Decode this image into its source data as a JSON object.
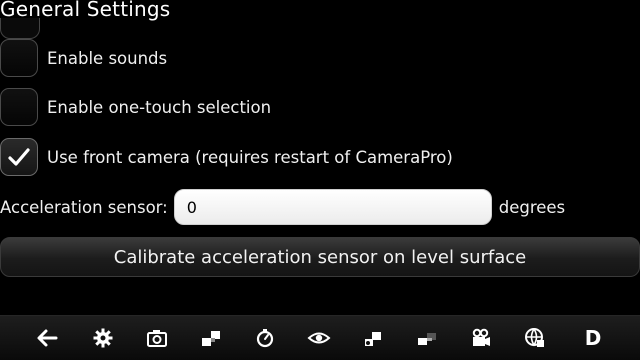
{
  "header": {
    "title": "General Settings"
  },
  "settings": {
    "sounds": {
      "label": "Enable sounds",
      "checked": false
    },
    "one_touch": {
      "label": "Enable one-touch selection",
      "checked": false
    },
    "front_camera": {
      "label": "Use front camera (requires restart of CameraPro)",
      "checked": true
    }
  },
  "acceleration": {
    "label": "Acceleration sensor:",
    "value": "0",
    "unit": "degrees"
  },
  "calibrate_button": {
    "label": "Calibrate acceleration sensor on level surface"
  },
  "toolbar": {
    "icons": [
      "back-arrow-icon",
      "gear-icon",
      "camera-icon",
      "flip-icon",
      "timer-icon",
      "eye-icon",
      "effects-icon",
      "exposure-icon",
      "video-camera-icon",
      "globe-icon",
      "d-icon"
    ],
    "d_label": "D"
  },
  "colors": {
    "background": "#000000",
    "text": "#f0f0f0",
    "input_bg": "#ffffff"
  }
}
